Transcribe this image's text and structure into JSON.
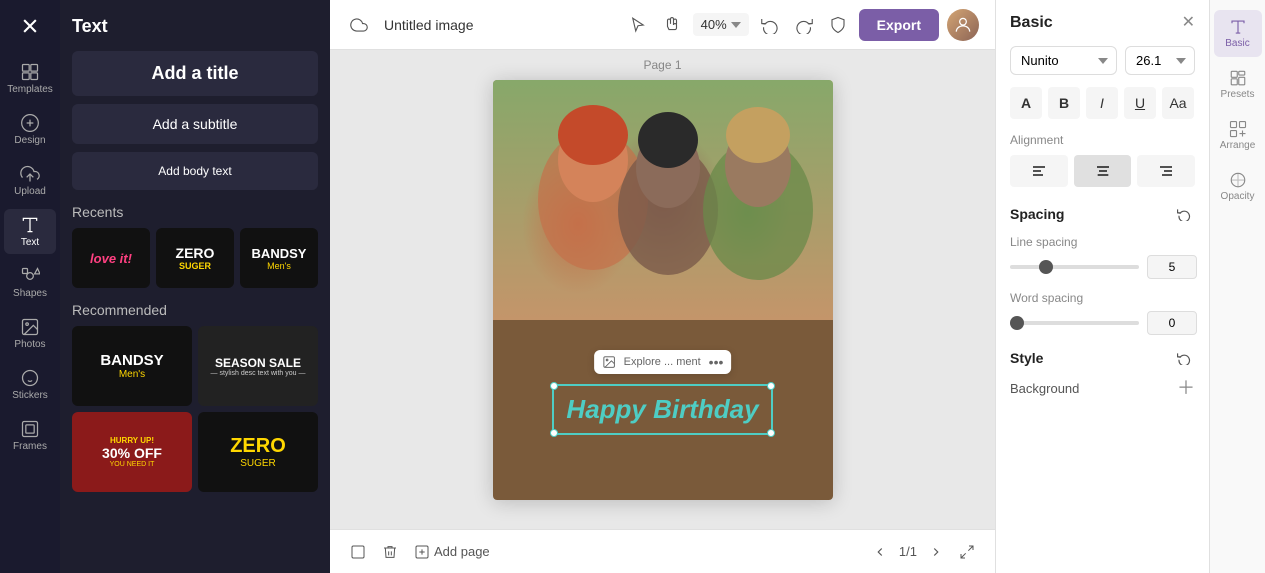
{
  "app": {
    "logo_icon": "x-icon",
    "title": "Untitled image"
  },
  "icon_bar": {
    "items": [
      {
        "id": "templates",
        "label": "Templates",
        "icon": "grid-icon"
      },
      {
        "id": "design",
        "label": "Design",
        "icon": "paint-icon"
      },
      {
        "id": "upload",
        "label": "Upload",
        "icon": "upload-icon"
      },
      {
        "id": "text",
        "label": "Text",
        "icon": "text-icon",
        "active": true
      },
      {
        "id": "shapes",
        "label": "Shapes",
        "icon": "shapes-icon"
      },
      {
        "id": "photos",
        "label": "Photos",
        "icon": "photo-icon"
      },
      {
        "id": "stickers",
        "label": "Stickers",
        "icon": "sticker-icon"
      },
      {
        "id": "frames",
        "label": "Frames",
        "icon": "frame-icon"
      }
    ]
  },
  "text_panel": {
    "title": "Text",
    "add_title_btn": "Add a title",
    "add_subtitle_btn": "Add a subtitle",
    "add_body_btn": "Add body text",
    "recents_label": "Recents",
    "recommended_label": "Recommended"
  },
  "canvas": {
    "page_label": "Page 1",
    "zoom": "40%",
    "birthday_text": "Happy Birthday",
    "floating_toolbar": {
      "icon": "image-icon",
      "more_icon": "more-icon",
      "explore_text": "Explore ... ment"
    }
  },
  "bottom_bar": {
    "add_page_label": "Add page",
    "page_counter": "1/1"
  },
  "properties_panel": {
    "title": "Basic",
    "font_family": "Nunito",
    "font_size": "26.1",
    "format_bold_label": "B",
    "format_italic_label": "I",
    "format_underline_label": "U",
    "format_case_label": "Aa",
    "alignment_label": "Alignment",
    "spacing_label": "Spacing",
    "reset_icon": "reset-icon",
    "line_spacing_label": "Line spacing",
    "line_spacing_value": "5",
    "word_spacing_label": "Word spacing",
    "word_spacing_value": "0",
    "style_label": "Style",
    "background_label": "Background"
  },
  "right_tabs": [
    {
      "id": "basic",
      "label": "Basic",
      "icon": "text-format-icon",
      "active": true
    },
    {
      "id": "presets",
      "label": "Presets",
      "icon": "presets-icon"
    },
    {
      "id": "arrange",
      "label": "Arrange",
      "icon": "arrange-icon"
    },
    {
      "id": "opacity",
      "label": "Opacity",
      "icon": "opacity-icon"
    }
  ],
  "colors": {
    "accent": "#7b5ea7",
    "export_bg": "#7b5ea7",
    "birthday_color": "#4ecdc4",
    "canvas_bg": "#7a5a3a",
    "active_tab_bg": "#e8e4f0"
  }
}
